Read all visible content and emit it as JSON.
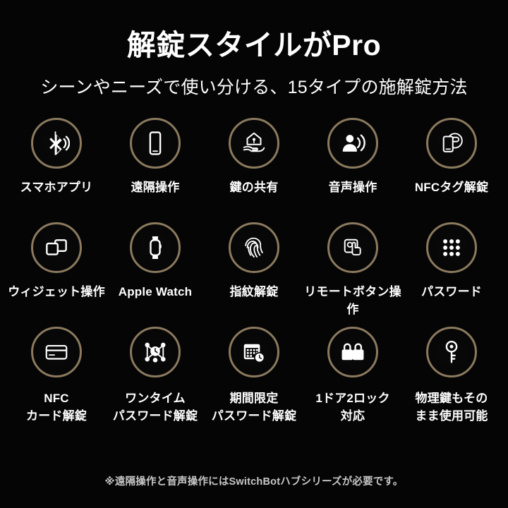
{
  "header": {
    "title": "解錠スタイルがPro",
    "subtitle": "シーンやニーズで使い分ける、15タイプの施解錠方法"
  },
  "colors": {
    "background": "#000000",
    "ring": "#8b7a5e",
    "icon": "#ffffff",
    "text": "#ffffff",
    "footnote": "#c7c7c7"
  },
  "grid": {
    "rows": [
      {
        "items": [
          {
            "label": "スマホアプリ",
            "icon": "bluetooth-icon"
          },
          {
            "label": "遠隔操作",
            "icon": "smartphone-icon"
          },
          {
            "label": "鍵の共有",
            "icon": "hand-house-key-icon"
          },
          {
            "label": "音声操作",
            "icon": "voice-person-icon"
          },
          {
            "label": "NFCタグ解錠",
            "icon": "nfc-tag-phone-icon"
          }
        ]
      },
      {
        "items": [
          {
            "label": "ウィジェット操作",
            "icon": "widget-squares-icon"
          },
          {
            "label": "Apple Watch",
            "icon": "apple-watch-icon"
          },
          {
            "label": "指紋解錠",
            "icon": "fingerprint-icon"
          },
          {
            "label": "リモートボタン操作",
            "icon": "remote-button-press-icon"
          },
          {
            "label": "パスワード",
            "icon": "keypad-dots-icon"
          }
        ]
      },
      {
        "items": [
          {
            "label": "NFC\nカード解錠",
            "icon": "nfc-card-icon"
          },
          {
            "label": "ワンタイム\nパスワード解錠",
            "icon": "one-time-password-icon"
          },
          {
            "label": "期間限定\nパスワード解錠",
            "icon": "calendar-clock-icon"
          },
          {
            "label": "1ドア2ロック\n対応",
            "icon": "double-lock-icon"
          },
          {
            "label": "物理鍵もその\nまま使用可能",
            "icon": "physical-key-icon"
          }
        ]
      }
    ]
  },
  "footnote": "※遠隔操作と音声操作にはSwitchBotハブシリーズが必要です。"
}
